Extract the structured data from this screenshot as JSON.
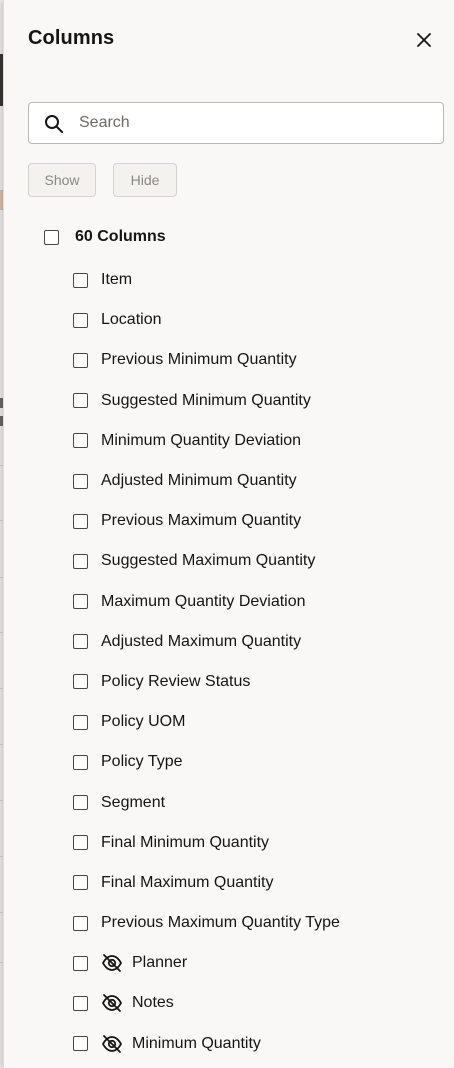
{
  "panel": {
    "title": "Columns",
    "close_icon": "close-icon"
  },
  "search": {
    "placeholder": "Search",
    "value": "",
    "icon": "search-icon"
  },
  "actions": {
    "show_label": "Show",
    "hide_label": "Hide"
  },
  "select_all": {
    "label": "60 Columns",
    "checked": false
  },
  "columns": [
    {
      "label": "Item",
      "checked": false,
      "hidden": false
    },
    {
      "label": "Location",
      "checked": false,
      "hidden": false
    },
    {
      "label": "Previous Minimum Quantity",
      "checked": false,
      "hidden": false
    },
    {
      "label": "Suggested Minimum Quantity",
      "checked": false,
      "hidden": false
    },
    {
      "label": "Minimum Quantity Deviation",
      "checked": false,
      "hidden": false
    },
    {
      "label": "Adjusted Minimum Quantity",
      "checked": false,
      "hidden": false
    },
    {
      "label": "Previous Maximum Quantity",
      "checked": false,
      "hidden": false
    },
    {
      "label": "Suggested Maximum Quantity",
      "checked": false,
      "hidden": false
    },
    {
      "label": "Maximum Quantity Deviation",
      "checked": false,
      "hidden": false
    },
    {
      "label": "Adjusted Maximum Quantity",
      "checked": false,
      "hidden": false
    },
    {
      "label": "Policy Review Status",
      "checked": false,
      "hidden": false
    },
    {
      "label": "Policy UOM",
      "checked": false,
      "hidden": false
    },
    {
      "label": "Policy Type",
      "checked": false,
      "hidden": false
    },
    {
      "label": "Segment",
      "checked": false,
      "hidden": false
    },
    {
      "label": "Final Minimum Quantity",
      "checked": false,
      "hidden": false
    },
    {
      "label": "Final Maximum Quantity",
      "checked": false,
      "hidden": false
    },
    {
      "label": "Previous Maximum Quantity Type",
      "checked": false,
      "hidden": false
    },
    {
      "label": "Planner",
      "checked": false,
      "hidden": true
    },
    {
      "label": "Notes",
      "checked": false,
      "hidden": true
    },
    {
      "label": "Minimum Quantity",
      "checked": false,
      "hidden": true
    }
  ],
  "hidden_icon": "eye-slash-icon",
  "colors": {
    "panel_bg": "#f9f8f6",
    "text": "#161513",
    "disabled_text": "#8b8782",
    "border": "#bdb9b4"
  }
}
